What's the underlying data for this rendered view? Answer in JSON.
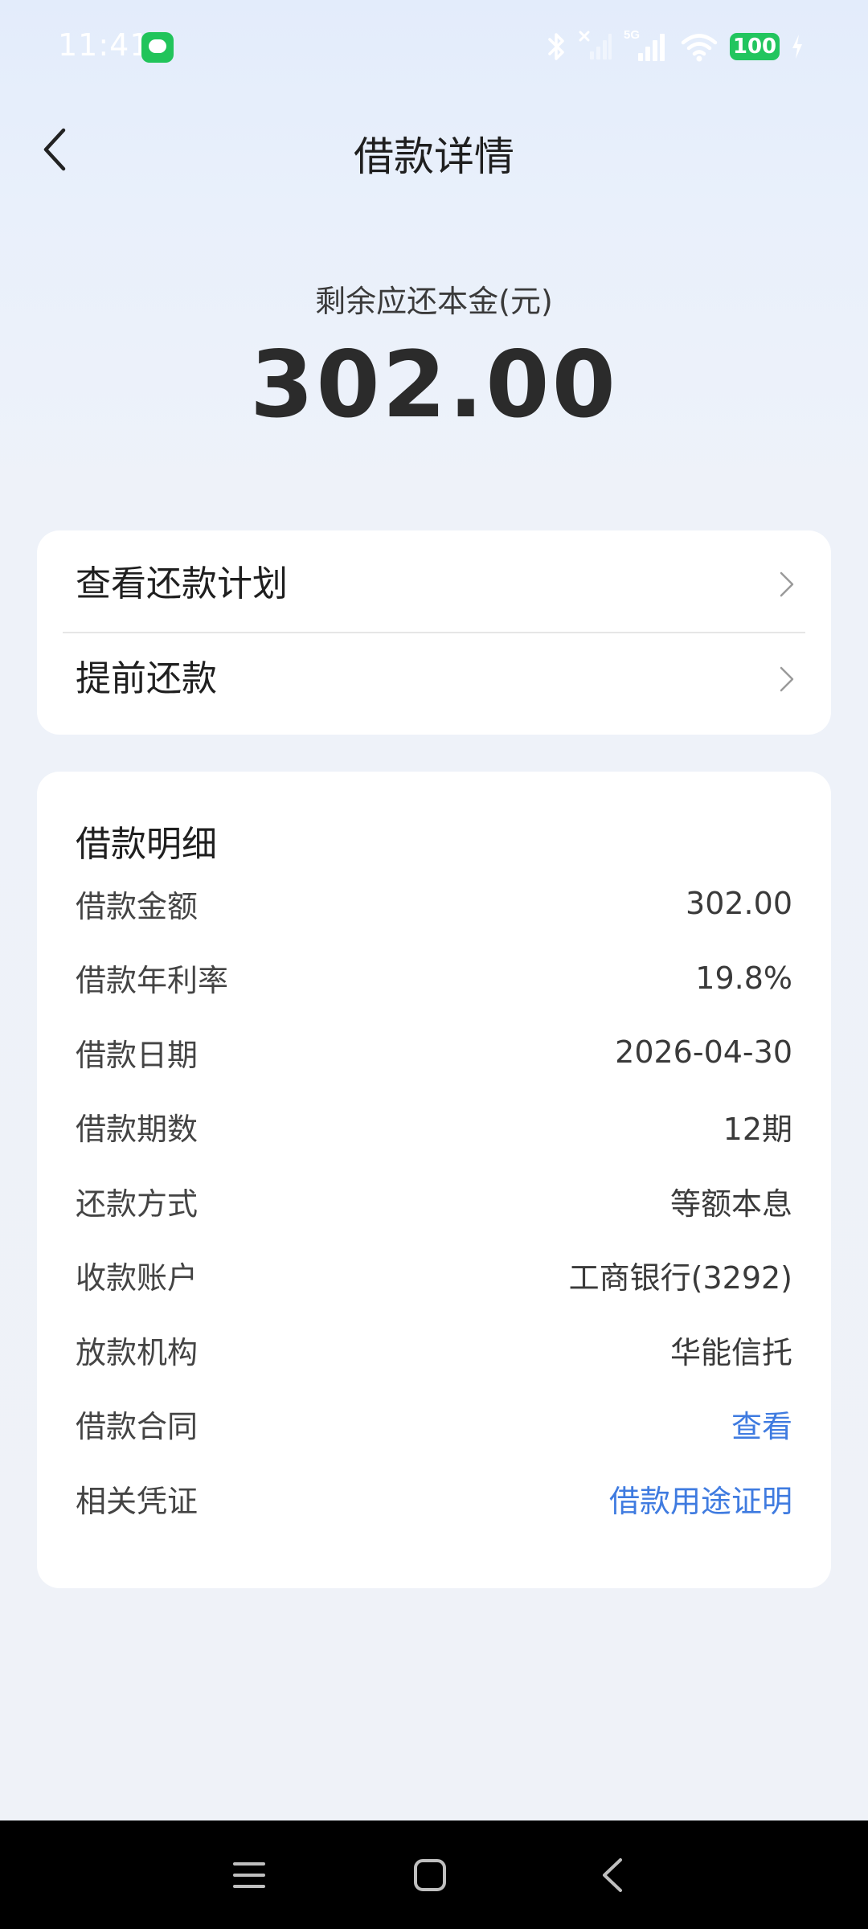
{
  "status_bar": {
    "time": "11:41",
    "network": "5G",
    "battery": "100",
    "icons": [
      "message-icon",
      "bluetooth-icon",
      "no-sim-signal-icon",
      "signal-icon",
      "wifi-icon",
      "battery-icon",
      "charging-icon"
    ]
  },
  "header": {
    "title": "借款详情",
    "back_icon": "chevron-left-icon"
  },
  "summary": {
    "label": "剩余应还本金(元)",
    "amount": "302.00"
  },
  "actions": [
    {
      "label": "查看还款计划",
      "icon": "chevron-right-icon"
    },
    {
      "label": "提前还款",
      "icon": "chevron-right-icon"
    }
  ],
  "details": {
    "title": "借款明细",
    "rows": [
      {
        "label": "借款金额",
        "value": "302.00"
      },
      {
        "label": "借款年利率",
        "value": "19.8%"
      },
      {
        "label": "借款日期",
        "value": "2026-04-30"
      },
      {
        "label": "借款期数",
        "value": "12期"
      },
      {
        "label": "还款方式",
        "value": "等额本息"
      },
      {
        "label": "收款账户",
        "value": "工商银行(3292)"
      },
      {
        "label": "放款机构",
        "value": "华能信托"
      },
      {
        "label": "借款合同",
        "value": "查看"
      },
      {
        "label": "相关凭证",
        "value": "借款用途证明"
      }
    ]
  },
  "nav_bar": {
    "icons": [
      "menu-icon",
      "home-icon",
      "back-icon"
    ]
  },
  "colors": {
    "link": "#3f7be0",
    "battery": "#22c55e",
    "background": "#eef2f9"
  }
}
